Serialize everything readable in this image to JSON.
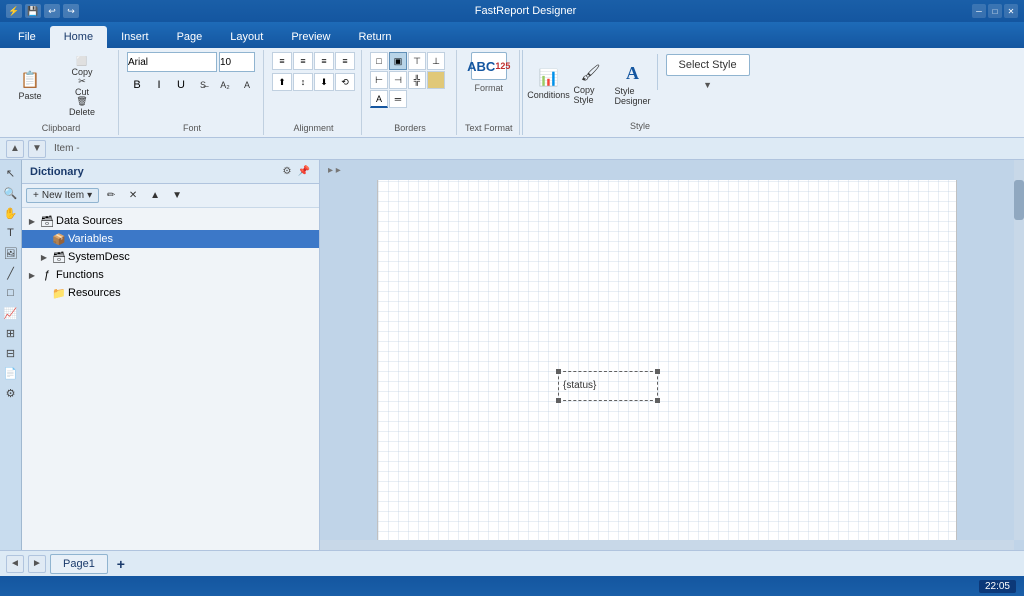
{
  "titlebar": {
    "title": "FastReport Designer",
    "icons": [
      "save-icon",
      "undo-icon",
      "redo-icon"
    ]
  },
  "ribbon": {
    "tabs": [
      {
        "id": "file",
        "label": "File"
      },
      {
        "id": "home",
        "label": "Home",
        "active": true
      },
      {
        "id": "insert",
        "label": "Insert"
      },
      {
        "id": "page",
        "label": "Page"
      },
      {
        "id": "layout",
        "label": "Layout"
      },
      {
        "id": "preview",
        "label": "Preview"
      },
      {
        "id": "return",
        "label": "Return"
      }
    ],
    "groups": {
      "clipboard": {
        "label": "Clipboard",
        "paste": "Paste",
        "copy": "Copy",
        "cut": "Cut",
        "delete": "Delete"
      },
      "font": {
        "label": "Font",
        "family": "Arial",
        "size": "10",
        "bold": "B",
        "italic": "I",
        "underline": "U"
      },
      "alignment": {
        "label": "Alignment"
      },
      "borders": {
        "label": "Borders"
      },
      "textformat": {
        "label": "Text Format"
      },
      "style": {
        "label": "Style",
        "select_style_label": "Select Style",
        "conditions_label": "Conditions",
        "copy_style_label": "Copy Style",
        "designer_label": "Style\nDesigner"
      }
    }
  },
  "toolbar2": {
    "item_label": "Item -"
  },
  "panel": {
    "title": "Dictionary",
    "new_item_label": "New Item",
    "tree": {
      "data_sources": {
        "label": "Data Sources",
        "children": [
          {
            "label": "Variables",
            "highlighted": true
          },
          {
            "label": "SystemDesc"
          }
        ]
      },
      "functions": {
        "label": "Functions",
        "children": [
          {
            "label": "Resources"
          }
        ]
      }
    }
  },
  "canvas": {
    "selection": {
      "text": "{status}"
    }
  },
  "bottom_tabs": {
    "nav_prev": "◄",
    "nav_next": "►",
    "tabs": [
      {
        "label": "Page1",
        "active": true
      }
    ],
    "add_label": "+"
  },
  "statusbar": {
    "time": "22:05"
  }
}
